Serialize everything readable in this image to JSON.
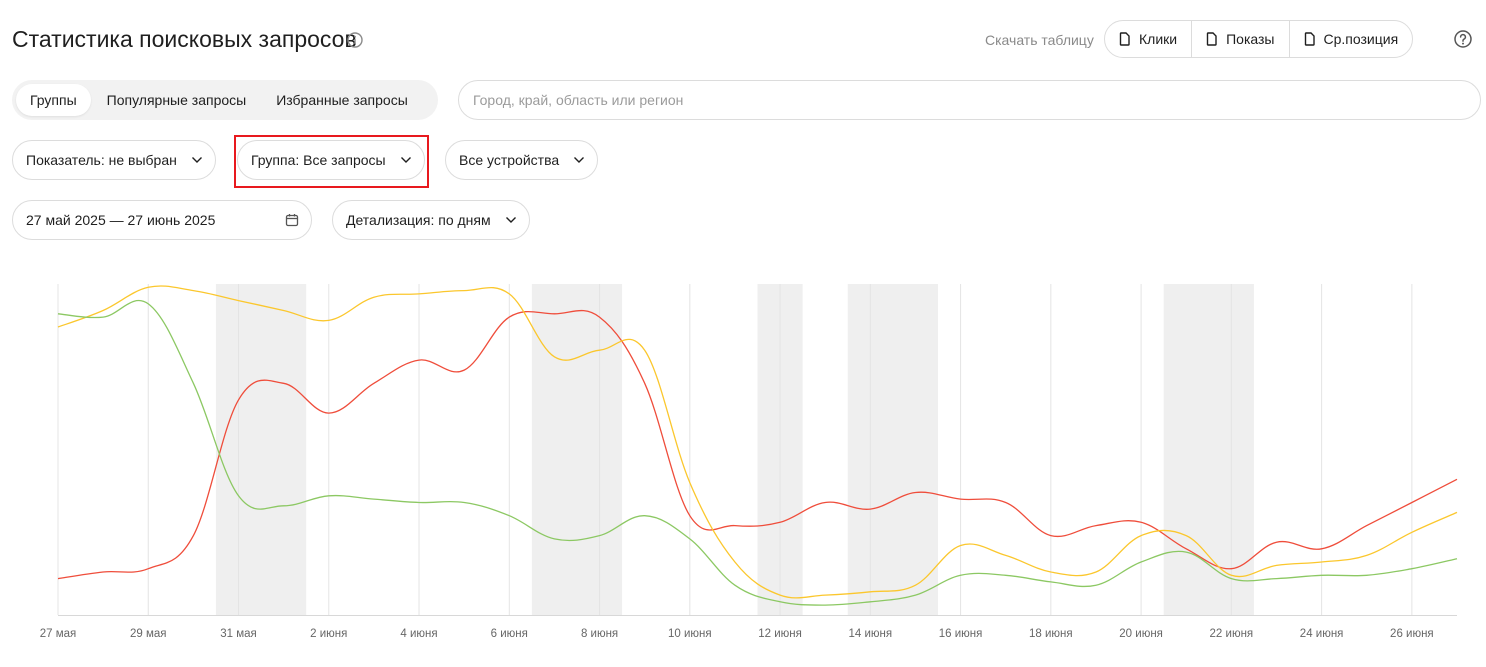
{
  "header": {
    "title": "Статистика поисковых запросов",
    "download_label": "Скачать таблицу",
    "download_buttons": [
      "Клики",
      "Показы",
      "Ср.позиция"
    ]
  },
  "tabs": [
    {
      "label": "Группы",
      "active": true
    },
    {
      "label": "Популярные запросы",
      "active": false
    },
    {
      "label": "Избранные запросы",
      "active": false
    }
  ],
  "region_search": {
    "placeholder": "Город, край, область или регион",
    "value": ""
  },
  "filters": {
    "metric": "Показатель: не выбран",
    "group": "Группа: Все запросы",
    "devices": "Все устройства",
    "date_range": "27 май 2025 — 27 июнь 2025",
    "detail": "Детализация: по дням"
  },
  "colors": {
    "red": "#ef4d3b",
    "yellow": "#fbc72d",
    "green": "#8cc863",
    "weekend": "#efefef",
    "highlight": "#e8191e"
  },
  "chart_data": {
    "type": "line",
    "x_tick_labels": [
      "27 мая",
      "29 мая",
      "31 мая",
      "2 июня",
      "4 июня",
      "6 июня",
      "8 июня",
      "10 июня",
      "12 июня",
      "14 июня",
      "16 июня",
      "18 июня",
      "20 июня",
      "22 июня",
      "24 июня",
      "26 июня"
    ],
    "x": [
      "2025-05-27",
      "2025-05-28",
      "2025-05-29",
      "2025-05-30",
      "2025-05-31",
      "2025-06-01",
      "2025-06-02",
      "2025-06-03",
      "2025-06-04",
      "2025-06-05",
      "2025-06-06",
      "2025-06-07",
      "2025-06-08",
      "2025-06-09",
      "2025-06-10",
      "2025-06-11",
      "2025-06-12",
      "2025-06-13",
      "2025-06-14",
      "2025-06-15",
      "2025-06-16",
      "2025-06-17",
      "2025-06-18",
      "2025-06-19",
      "2025-06-20",
      "2025-06-21",
      "2025-06-22",
      "2025-06-23",
      "2025-06-24",
      "2025-06-25",
      "2025-06-26",
      "2025-06-27"
    ],
    "weekend_bands": [
      [
        "2025-05-31",
        "2025-06-01"
      ],
      [
        "2025-06-07",
        "2025-06-08"
      ],
      [
        "2025-06-12",
        "2025-06-12"
      ],
      [
        "2025-06-14",
        "2025-06-15"
      ],
      [
        "2025-06-21",
        "2025-06-22"
      ]
    ],
    "ylim": [
      0,
      100
    ],
    "y_axis_labels": false,
    "grid": true,
    "legend": "none",
    "series": [
      {
        "color": "red",
        "values": [
          11,
          13,
          14,
          24,
          65,
          70,
          61,
          70,
          77,
          74,
          90,
          91,
          90,
          70,
          30,
          27,
          28,
          34,
          32,
          37,
          35,
          34,
          24,
          27,
          28,
          20,
          14,
          22,
          20,
          27,
          34,
          41
        ]
      },
      {
        "color": "yellow",
        "values": [
          87,
          92,
          99,
          98,
          95,
          92,
          89,
          96,
          97,
          98,
          97,
          78,
          80,
          80,
          40,
          16,
          6,
          6,
          7,
          9,
          21,
          18,
          13,
          13,
          24,
          24,
          12,
          15,
          16,
          18,
          25,
          31
        ]
      },
      {
        "color": "green",
        "values": [
          91,
          90,
          94,
          70,
          36,
          33,
          36,
          35,
          34,
          34,
          30,
          23,
          24,
          30,
          23,
          9,
          4,
          3,
          4,
          6,
          12,
          12,
          10,
          9,
          16,
          19,
          11,
          11,
          12,
          12,
          14,
          17
        ]
      }
    ]
  }
}
